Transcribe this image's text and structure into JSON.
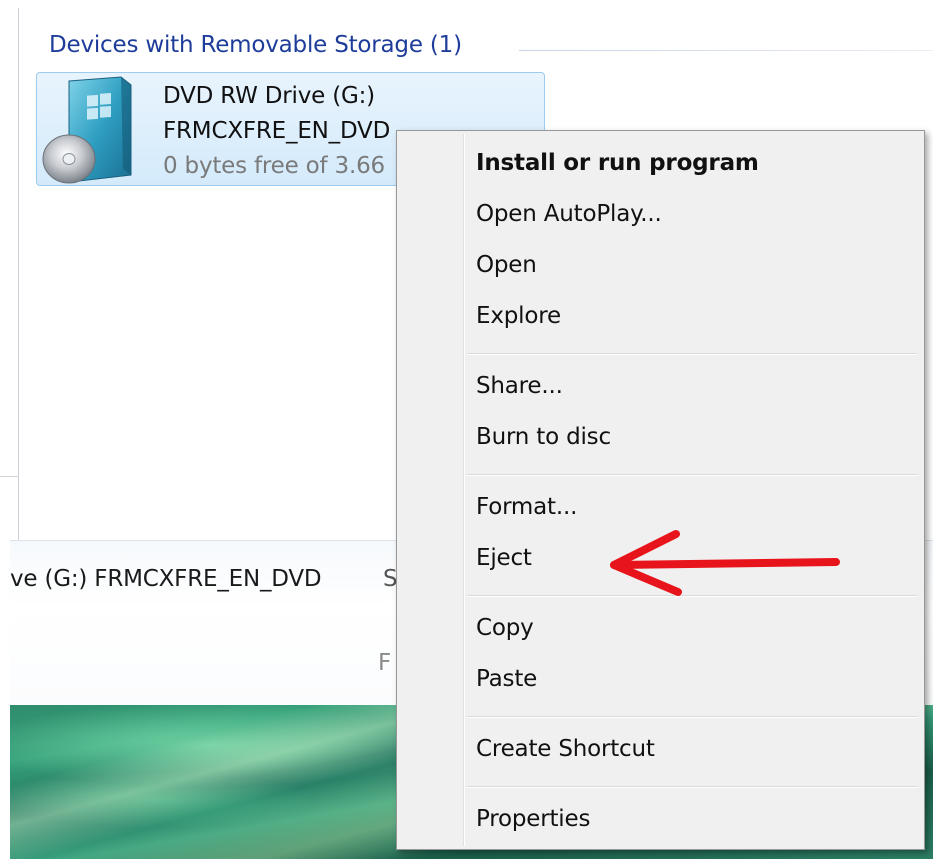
{
  "explorer": {
    "group_title": "Devices with Removable Storage (1)",
    "drive": {
      "name": "DVD RW Drive (G:)",
      "label": "FRMCXFRE_EN_DVD",
      "space": "0 bytes free of 3.66"
    }
  },
  "details_pane": {
    "text": "ve (G:) FRMCXFRE_EN_DVD",
    "extra": "S",
    "extra2": "F"
  },
  "context_menu": {
    "items": [
      {
        "label": "Install or run program",
        "bold": true
      },
      {
        "label": "Open AutoPlay..."
      },
      {
        "label": "Open"
      },
      {
        "label": "Explore"
      },
      {
        "label": "Share..."
      },
      {
        "label": "Burn to disc"
      },
      {
        "label": "Format..."
      },
      {
        "label": "Eject"
      },
      {
        "label": "Copy"
      },
      {
        "label": "Paste"
      },
      {
        "label": "Create Shortcut"
      },
      {
        "label": "Properties"
      }
    ]
  },
  "annotation": {
    "arrow_color": "#e8141b",
    "points_to": "Eject",
    "icon": "red-arrow-icon"
  },
  "colors": {
    "group_title": "#1e3d9a",
    "selection_fill": "#d4eafb",
    "selection_border": "#9ccbee",
    "menu_background": "#f0f0f0"
  }
}
